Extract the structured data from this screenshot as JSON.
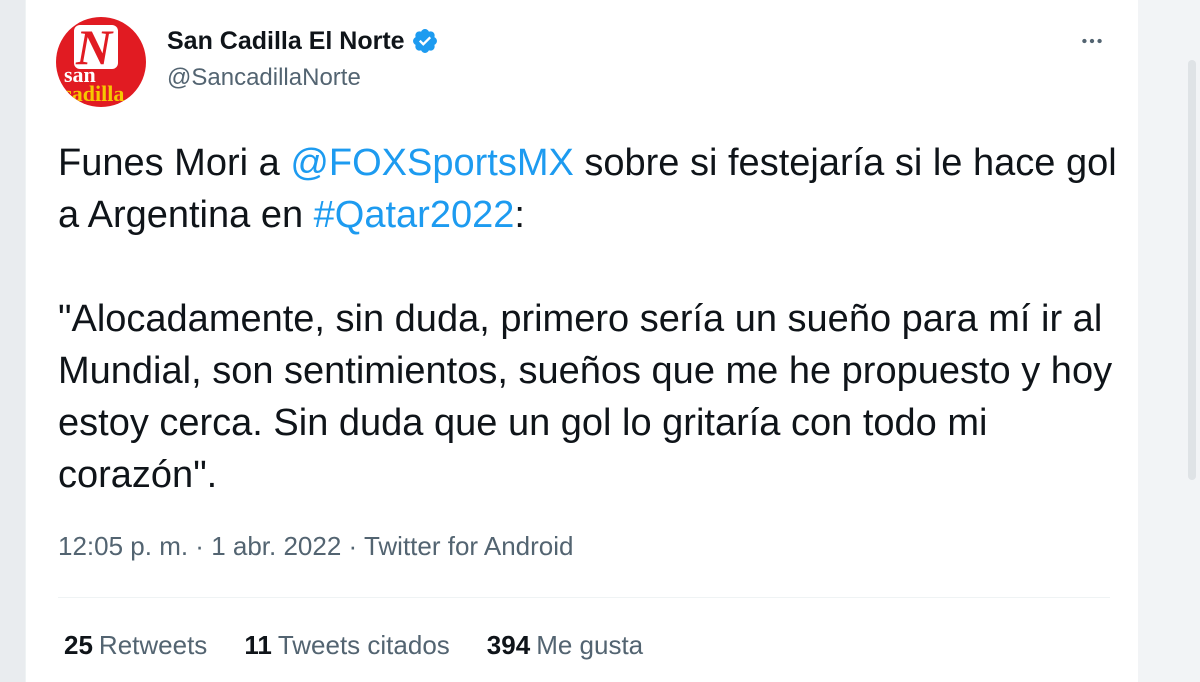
{
  "account": {
    "display_name": "San Cadilla El Norte",
    "handle": "@SancadillaNorte",
    "avatar": {
      "logo_text": [
        "N",
        "san",
        "cadilla"
      ],
      "colors": {
        "background": "#e11b22",
        "accent": "#f6c700"
      }
    }
  },
  "tweet": {
    "text_part1_prefix": "Funes Mori a ",
    "mention": "@FOXSportsMX",
    "text_part1_middle": " sobre si festejaría si le hace gol a Argentina en ",
    "hashtag": "#Qatar2022",
    "text_part1_suffix": ":",
    "quote": "\"Alocadamente, sin duda, primero sería un sueño para mí ir al Mundial, son sentimientos, sueños que me he propuesto y hoy estoy cerca. Sin duda que un gol lo gritaría con todo mi corazón\"."
  },
  "meta": {
    "time": "12:05 p. m.",
    "separator": " · ",
    "date": "1 abr. 2022",
    "source": "Twitter for Android"
  },
  "stats": {
    "retweets_count": "25",
    "retweets_label": "Retweets",
    "quotes_count": "11",
    "quotes_label": "Tweets citados",
    "likes_count": "394",
    "likes_label": "Me gusta"
  },
  "icons": {
    "verified": "verified-badge-icon",
    "more": "more-options-icon"
  },
  "colors": {
    "link": "#1d9bf0",
    "text": "#0f1419",
    "secondary": "#536471"
  }
}
